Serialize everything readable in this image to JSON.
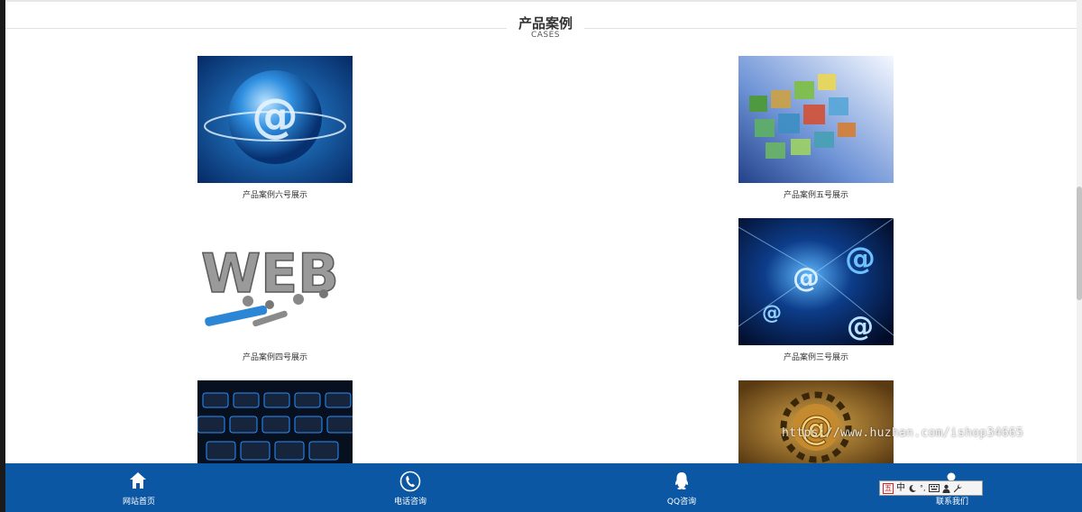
{
  "section": {
    "title": "产品案例",
    "subtitle": "CASES"
  },
  "cases": [
    {
      "caption": "产品案例六号展示",
      "image": "blue-at-sphere"
    },
    {
      "caption": "产品案例五号展示",
      "image": "floating-photo-panels"
    },
    {
      "caption": "产品案例四号展示",
      "image": "web-3d-letters-tools"
    },
    {
      "caption": "产品案例三号展示",
      "image": "digital-at-symbols"
    },
    {
      "caption": "",
      "image": "blue-keyboard"
    },
    {
      "caption": "",
      "image": "golden-at-gear"
    }
  ],
  "watermark": "https://www.huzhan.com/ishop34665",
  "footer": {
    "items": [
      {
        "label": "网站首页",
        "icon": "home-icon"
      },
      {
        "label": "电话咨询",
        "icon": "phone-icon"
      },
      {
        "label": "QQ咨询",
        "icon": "qq-icon"
      },
      {
        "label": "联系我们",
        "icon": "user-icon"
      }
    ]
  },
  "ime": {
    "mode_label": "五",
    "lang_label": "中",
    "punct_label": "°,"
  },
  "colors": {
    "footer_bg": "#0b57a4",
    "header_line": "#e2e2e2"
  }
}
